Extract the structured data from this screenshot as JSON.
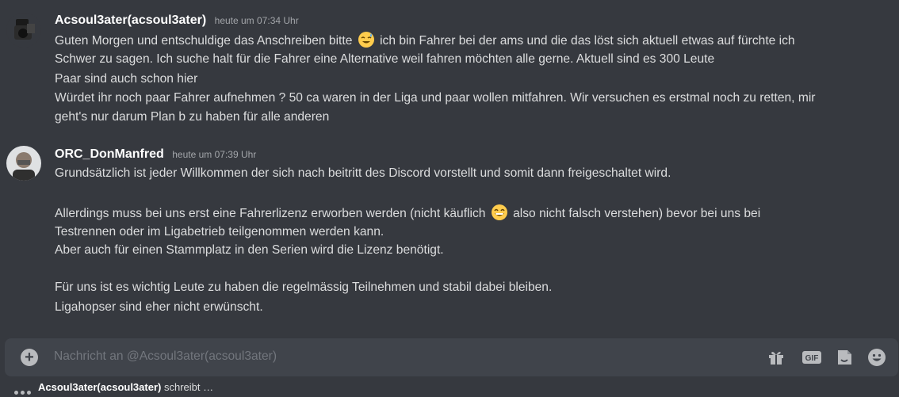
{
  "messages": [
    {
      "author": "Acsoul3ater(acsoul3ater)",
      "timestamp": "heute um 07:34 Uhr",
      "lines": {
        "l1a": "Guten Morgen und entschuldige das Anschreiben bitte",
        "l1b": "ich bin Fahrer bei der ams und die das löst sich aktuell etwas auf fürchte ich",
        "l2": "Schwer zu sagen. Ich suche halt für die Fahrer eine Alternative weil fahren möchten alle gerne. Aktuell sind es 300 Leute",
        "l3": "Paar sind auch schon hier",
        "l4": "Würdet ihr noch paar Fahrer aufnehmen ? 50 ca waren in der Liga und paar wollen mitfahren. Wir versuchen es erstmal noch zu retten, mir",
        "l5": "geht's nur darum Plan b zu haben für alle anderen"
      },
      "emoji": "sweat-smile-emoji"
    },
    {
      "author": "ORC_DonManfred",
      "timestamp": "heute um 07:39 Uhr",
      "lines": {
        "l1": "Grundsätzlich ist jeder Willkommen der sich nach beitritt des Discord vorstellt und somit dann freigeschaltet wird.",
        "l2a": "Allerdings muss bei uns erst eine Fahrerlizenz erworben werden (nicht käuflich",
        "l2b": "also nicht falsch verstehen) bevor bei uns bei",
        "l3": "Testrennen oder im Ligabetrieb teilgenommen werden kann.",
        "l4": "Aber auch für einen Stammplatz in den Serien wird die Lizenz benötigt.",
        "l5": "Für uns ist es wichtig Leute zu haben die regelmässig Teilnehmen und stabil dabei bleiben.",
        "l6": "Ligahopser sind eher nicht erwünscht."
      },
      "emoji": "grin-emoji"
    }
  ],
  "composer": {
    "placeholder": "Nachricht an @Acsoul3ater(acsoul3ater)",
    "tools": [
      "gift-icon",
      "gif-icon",
      "sticker-icon",
      "emoji-icon"
    ]
  },
  "typing": {
    "name": "Acsoul3ater(acsoul3ater)",
    "suffix": "schreibt …"
  },
  "colors": {
    "background": "#36393f",
    "composer": "#40444b",
    "text": "#dcddde",
    "muted": "#72767d"
  }
}
